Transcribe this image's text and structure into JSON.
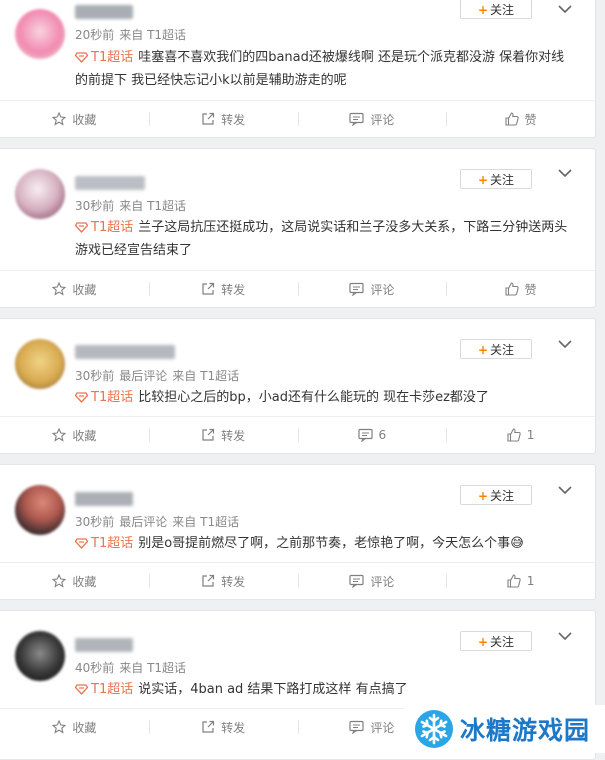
{
  "posts": [
    {
      "time": "20秒前",
      "extra": "",
      "source": "来自 T1超话",
      "topic": "T1超话",
      "text": "哇塞喜不喜欢我们的四banad还被爆线啊 还是玩个派克都没游 保着你对线的前提下 我已经快忘记小k以前是辅助游走的呢",
      "follow": "关注",
      "actions": {
        "fav": "收藏",
        "repost": "转发",
        "comment": "评论",
        "like": "赞"
      },
      "avatar_colors": [
        "#f5c2d0",
        "#f28bb0"
      ],
      "name_color": "#9aa0a8"
    },
    {
      "time": "30秒前",
      "extra": "",
      "source": "来自 T1超话",
      "topic": "T1超话",
      "text": "兰子这局抗压还挺成功，这局说实话和兰子没多大关系，下路三分钟送两头游戏已经宣告结束了",
      "follow": "关注",
      "actions": {
        "fav": "收藏",
        "repost": "转发",
        "comment": "评论",
        "like": "赞"
      },
      "avatar_colors": [
        "#f2e6ea",
        "#c9a5b8"
      ],
      "name_color": "#b0b5bb"
    },
    {
      "time": "30秒前",
      "extra": "最后评论",
      "source": "来自 T1超话",
      "topic": "T1超话",
      "text": "比较担心之后的bp，小ad还有什么能玩的 现在卡莎ez都没了",
      "follow": "关注",
      "actions": {
        "fav": "收藏",
        "repost": "转发",
        "comment": "6",
        "like": "1"
      },
      "avatar_colors": [
        "#e8c36a",
        "#b08a3c"
      ],
      "name_color": "#a8adb4"
    },
    {
      "time": "30秒前",
      "extra": "最后评论",
      "source": "来自 T1超话",
      "topic": "T1超话",
      "text": "别是o哥提前燃尽了啊，之前那节奏，老惊艳了啊，今天怎么个事",
      "emoji": "😅",
      "follow": "关注",
      "actions": {
        "fav": "收藏",
        "repost": "转发",
        "comment": "评论",
        "like": "1"
      },
      "avatar_colors": [
        "#c96a5a",
        "#3a2a2a"
      ],
      "name_color": "#9ea3aa"
    },
    {
      "time": "40秒前",
      "extra": "",
      "source": "来自 T1超话",
      "topic": "T1超话",
      "text": "说实话，4ban ad 结果下路打成这样 有点搞了",
      "follow": "关注",
      "actions": {
        "fav": "收藏",
        "repost": "转发",
        "comment": "评论",
        "like": "赞"
      },
      "avatar_colors": [
        "#6a6a6a",
        "#1e1e1e"
      ],
      "name_color": "#a4a9af"
    }
  ],
  "watermark": {
    "text": "冰糖游戏园",
    "icon": "snowflake-logo-icon",
    "color": "#1e78c8"
  }
}
